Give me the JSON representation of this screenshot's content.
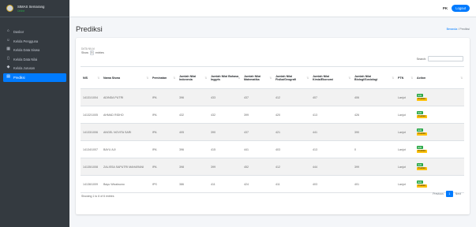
{
  "brand": {
    "name": "SIMAS Semarang",
    "status": "Online"
  },
  "sidebar": {
    "items": [
      {
        "label": "Dasbor",
        "icon": "home-icon"
      },
      {
        "label": "Kelola Pengguna",
        "icon": "users-icon"
      },
      {
        "label": "Kelola Data Siswa",
        "icon": "table-icon"
      },
      {
        "label": "Kelola Data Nilai",
        "icon": "file-icon"
      },
      {
        "label": "Kelola Jurusan",
        "icon": "graduation-cap-icon"
      },
      {
        "label": "Prediksi",
        "icon": "chart-icon"
      }
    ],
    "active_index": 5
  },
  "topbar": {
    "user": "PK",
    "logout_label": "Logout"
  },
  "page": {
    "title": "Prediksi",
    "breadcrumb": {
      "home": "Beranda",
      "current": "Prediksi"
    }
  },
  "card": {
    "heading": "DATA NILAI",
    "show": "Show",
    "entries_value": "5",
    "entries": "entries",
    "search_label": "Search:"
  },
  "table": {
    "columns": [
      "NIS",
      "Nama Siswa",
      "Peminatan",
      "Jumlah Nilai Indonesia",
      "Jumlah Nilai Bahasa Inggris",
      "Jumlah Nilai Matematika",
      "Jumlah Nilai Fisika/Geografi",
      "Jumlah Nilai Kimia/Ekonomi",
      "Jumlah Nilai Biologi/Sosiologi",
      "PTN",
      "Action"
    ],
    "rows": [
      [
        "14131/1004",
        "ADINDA PUTRI",
        "IPA",
        "396",
        "433",
        "437",
        "412",
        "407",
        "406",
        "Lanjut"
      ],
      [
        "14132/1005",
        "AHMAD RIDHO",
        "IPA",
        "432",
        "432",
        "399",
        "420",
        "413",
        "426",
        "Lanjut"
      ],
      [
        "14133/1006",
        "ANGEL NOVITA SARI",
        "IPA",
        "405",
        "390",
        "437",
        "421",
        "441",
        "390",
        "Lanjut"
      ],
      [
        "14134/1007",
        "BAYU AJI",
        "IPA",
        "396",
        "415",
        "441",
        "403",
        "413",
        "0",
        "Lanjut"
      ],
      [
        "14135/1008",
        "ZALISSA SAPUTRI MAHARANI",
        "IPA",
        "398",
        "399",
        "452",
        "412",
        "444",
        "399",
        "Lanjut"
      ],
      [
        "14136/1009",
        "Bayu Wicaksono",
        "IPS",
        "386",
        "411",
        "424",
        "411",
        "403",
        "401",
        "Lanjut"
      ]
    ],
    "btn_detail": "Edit",
    "btn_predict": "Prediksi"
  },
  "footer": {
    "info": "Showing 1 to 6 of 6 entries",
    "prev": "Previous",
    "page": "1",
    "next": "Next"
  }
}
